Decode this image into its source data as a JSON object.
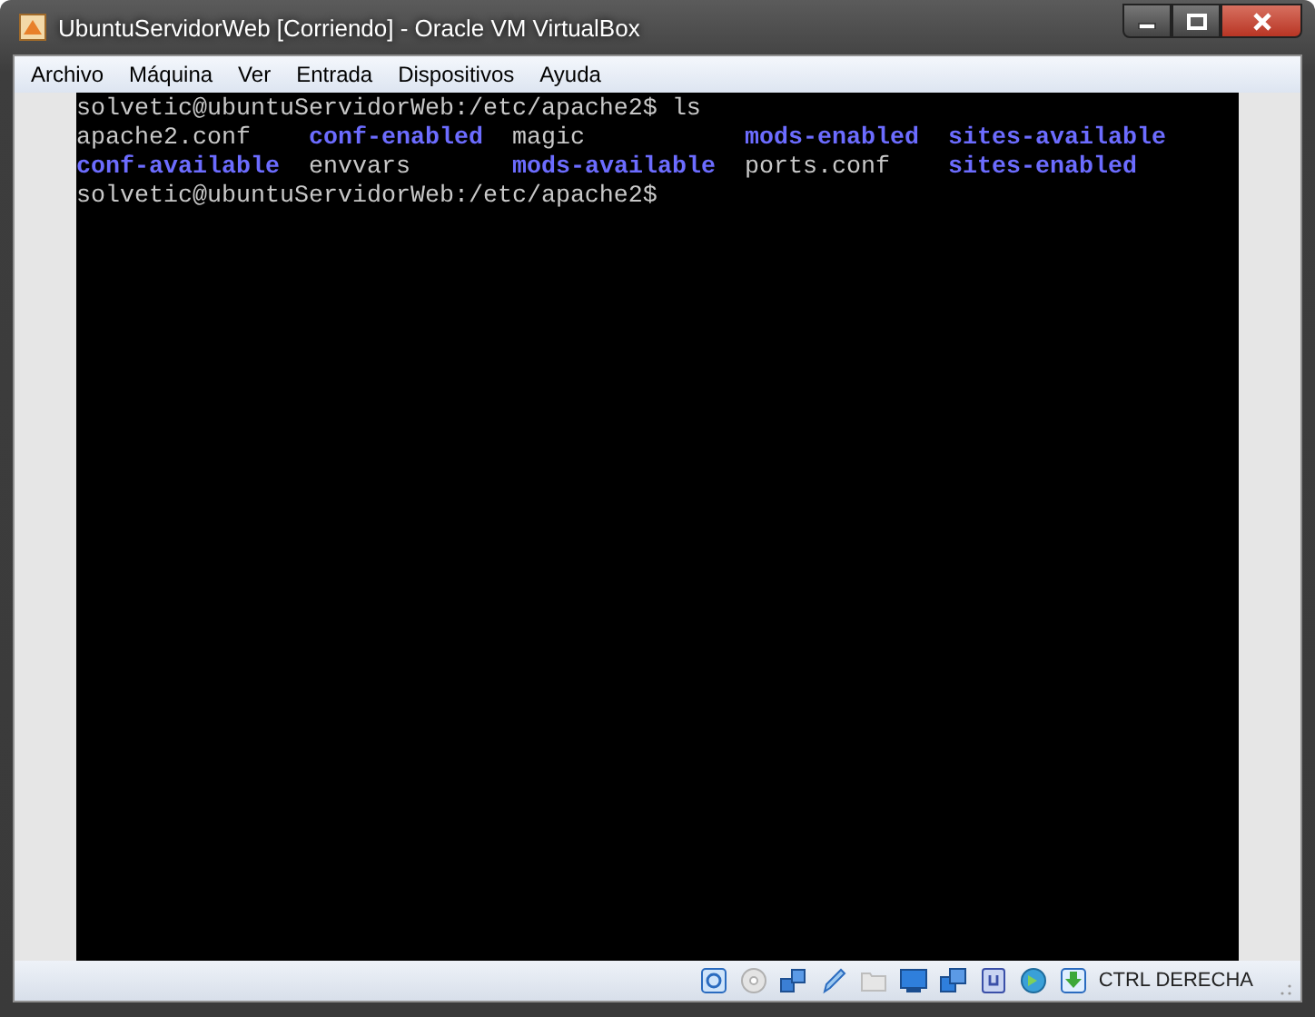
{
  "window": {
    "title": "UbuntuServidorWeb [Corriendo] - Oracle VM VirtualBox"
  },
  "menu": [
    "Archivo",
    "Máquina",
    "Ver",
    "Entrada",
    "Dispositivos",
    "Ayuda"
  ],
  "terminal": {
    "lines": [
      {
        "kind": "prompt",
        "text": "solvetic@ubuntuServidorWeb:/etc/apache2$",
        "command": "ls"
      },
      {
        "kind": "listing",
        "entries": [
          {
            "name": "apache2.conf",
            "kind": "file"
          },
          {
            "name": "conf-enabled",
            "kind": "dir"
          },
          {
            "name": "magic",
            "kind": "file"
          },
          {
            "name": "mods-enabled",
            "kind": "dir"
          },
          {
            "name": "sites-available",
            "kind": "dir"
          },
          {
            "name": "conf-available",
            "kind": "dir"
          },
          {
            "name": "envvars",
            "kind": "file"
          },
          {
            "name": "mods-available",
            "kind": "dir"
          },
          {
            "name": "ports.conf",
            "kind": "file"
          },
          {
            "name": "sites-enabled",
            "kind": "dir"
          }
        ]
      },
      {
        "kind": "prompt",
        "text": "solvetic@ubuntuServidorWeb:/etc/apache2$"
      }
    ]
  },
  "status_bar": {
    "host_key": "CTRL DERECHA"
  }
}
